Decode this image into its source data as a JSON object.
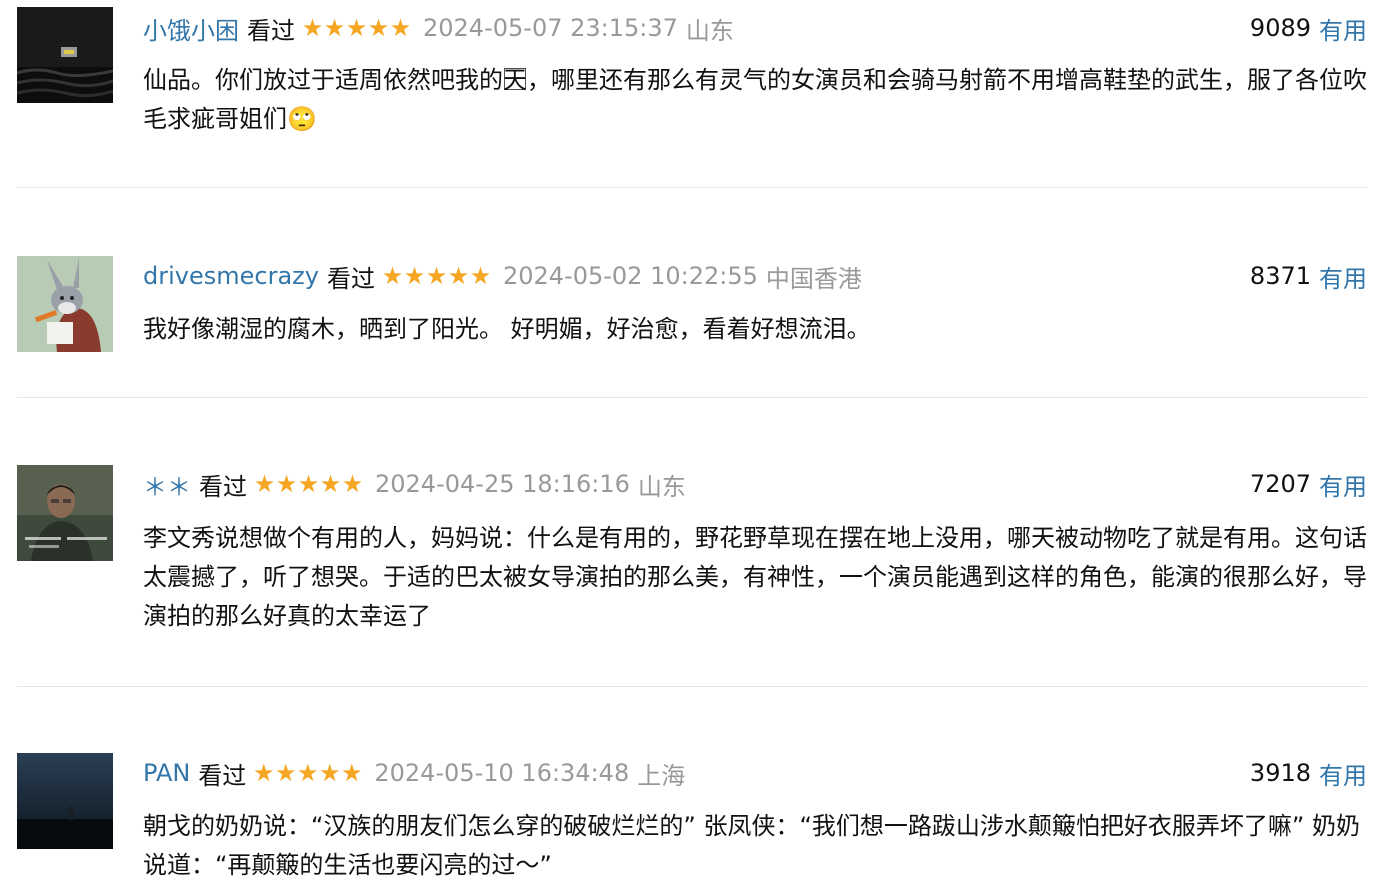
{
  "comments": [
    {
      "user": "小饿小困",
      "status": "看过",
      "rating": 5,
      "time": "2024-05-07 23:15:37",
      "location": "山东",
      "votes": "9089",
      "useful_label": "有用",
      "text": "仙品。你们放过于适周依然吧我的天⃞，哪里还有那么有灵气的女演员和会骑马射箭不用增高鞋垫的武生，服了各位吹毛求疵哥姐们🙄"
    },
    {
      "user": "drivesmecrazy",
      "status": "看过",
      "rating": 5,
      "time": "2024-05-02 10:22:55",
      "location": "中国香港",
      "votes": "8371",
      "useful_label": "有用",
      "text": "我好像潮湿的腐木，晒到了阳光。 好明媚，好治愈，看着好想流泪。"
    },
    {
      "user": "＊＊",
      "status": "看过",
      "rating": 5,
      "time": "2024-04-25 18:16:16",
      "location": "山东",
      "votes": "7207",
      "useful_label": "有用",
      "text": "李文秀说想做个有用的人，妈妈说：什么是有用的，野花野草现在摆在地上没用，哪天被动物吃了就是有用。这句话太震撼了，听了想哭。于适的巴太被女导演拍的那么美，有神性，一个演员能遇到这样的角色，能演的很那么好，导演拍的那么好真的太幸运了"
    },
    {
      "user": "PAN",
      "status": "看过",
      "rating": 5,
      "time": "2024-05-10 16:34:48",
      "location": "上海",
      "votes": "3918",
      "useful_label": "有用",
      "text": "朝戈的奶奶说：“汉族的朋友们怎么穿的破破烂烂的” 张凤侠：“我们想一路跋山涉水颠簸怕把好衣服弄坏了嘛” 奶奶说道：“再颠簸的生活也要闪亮的过～”"
    }
  ],
  "colors": {
    "link": "#3377aa",
    "star": "#f5a623",
    "meta": "#999999",
    "divider": "#e5e5e5"
  },
  "icons": {
    "star": "star-icon"
  }
}
